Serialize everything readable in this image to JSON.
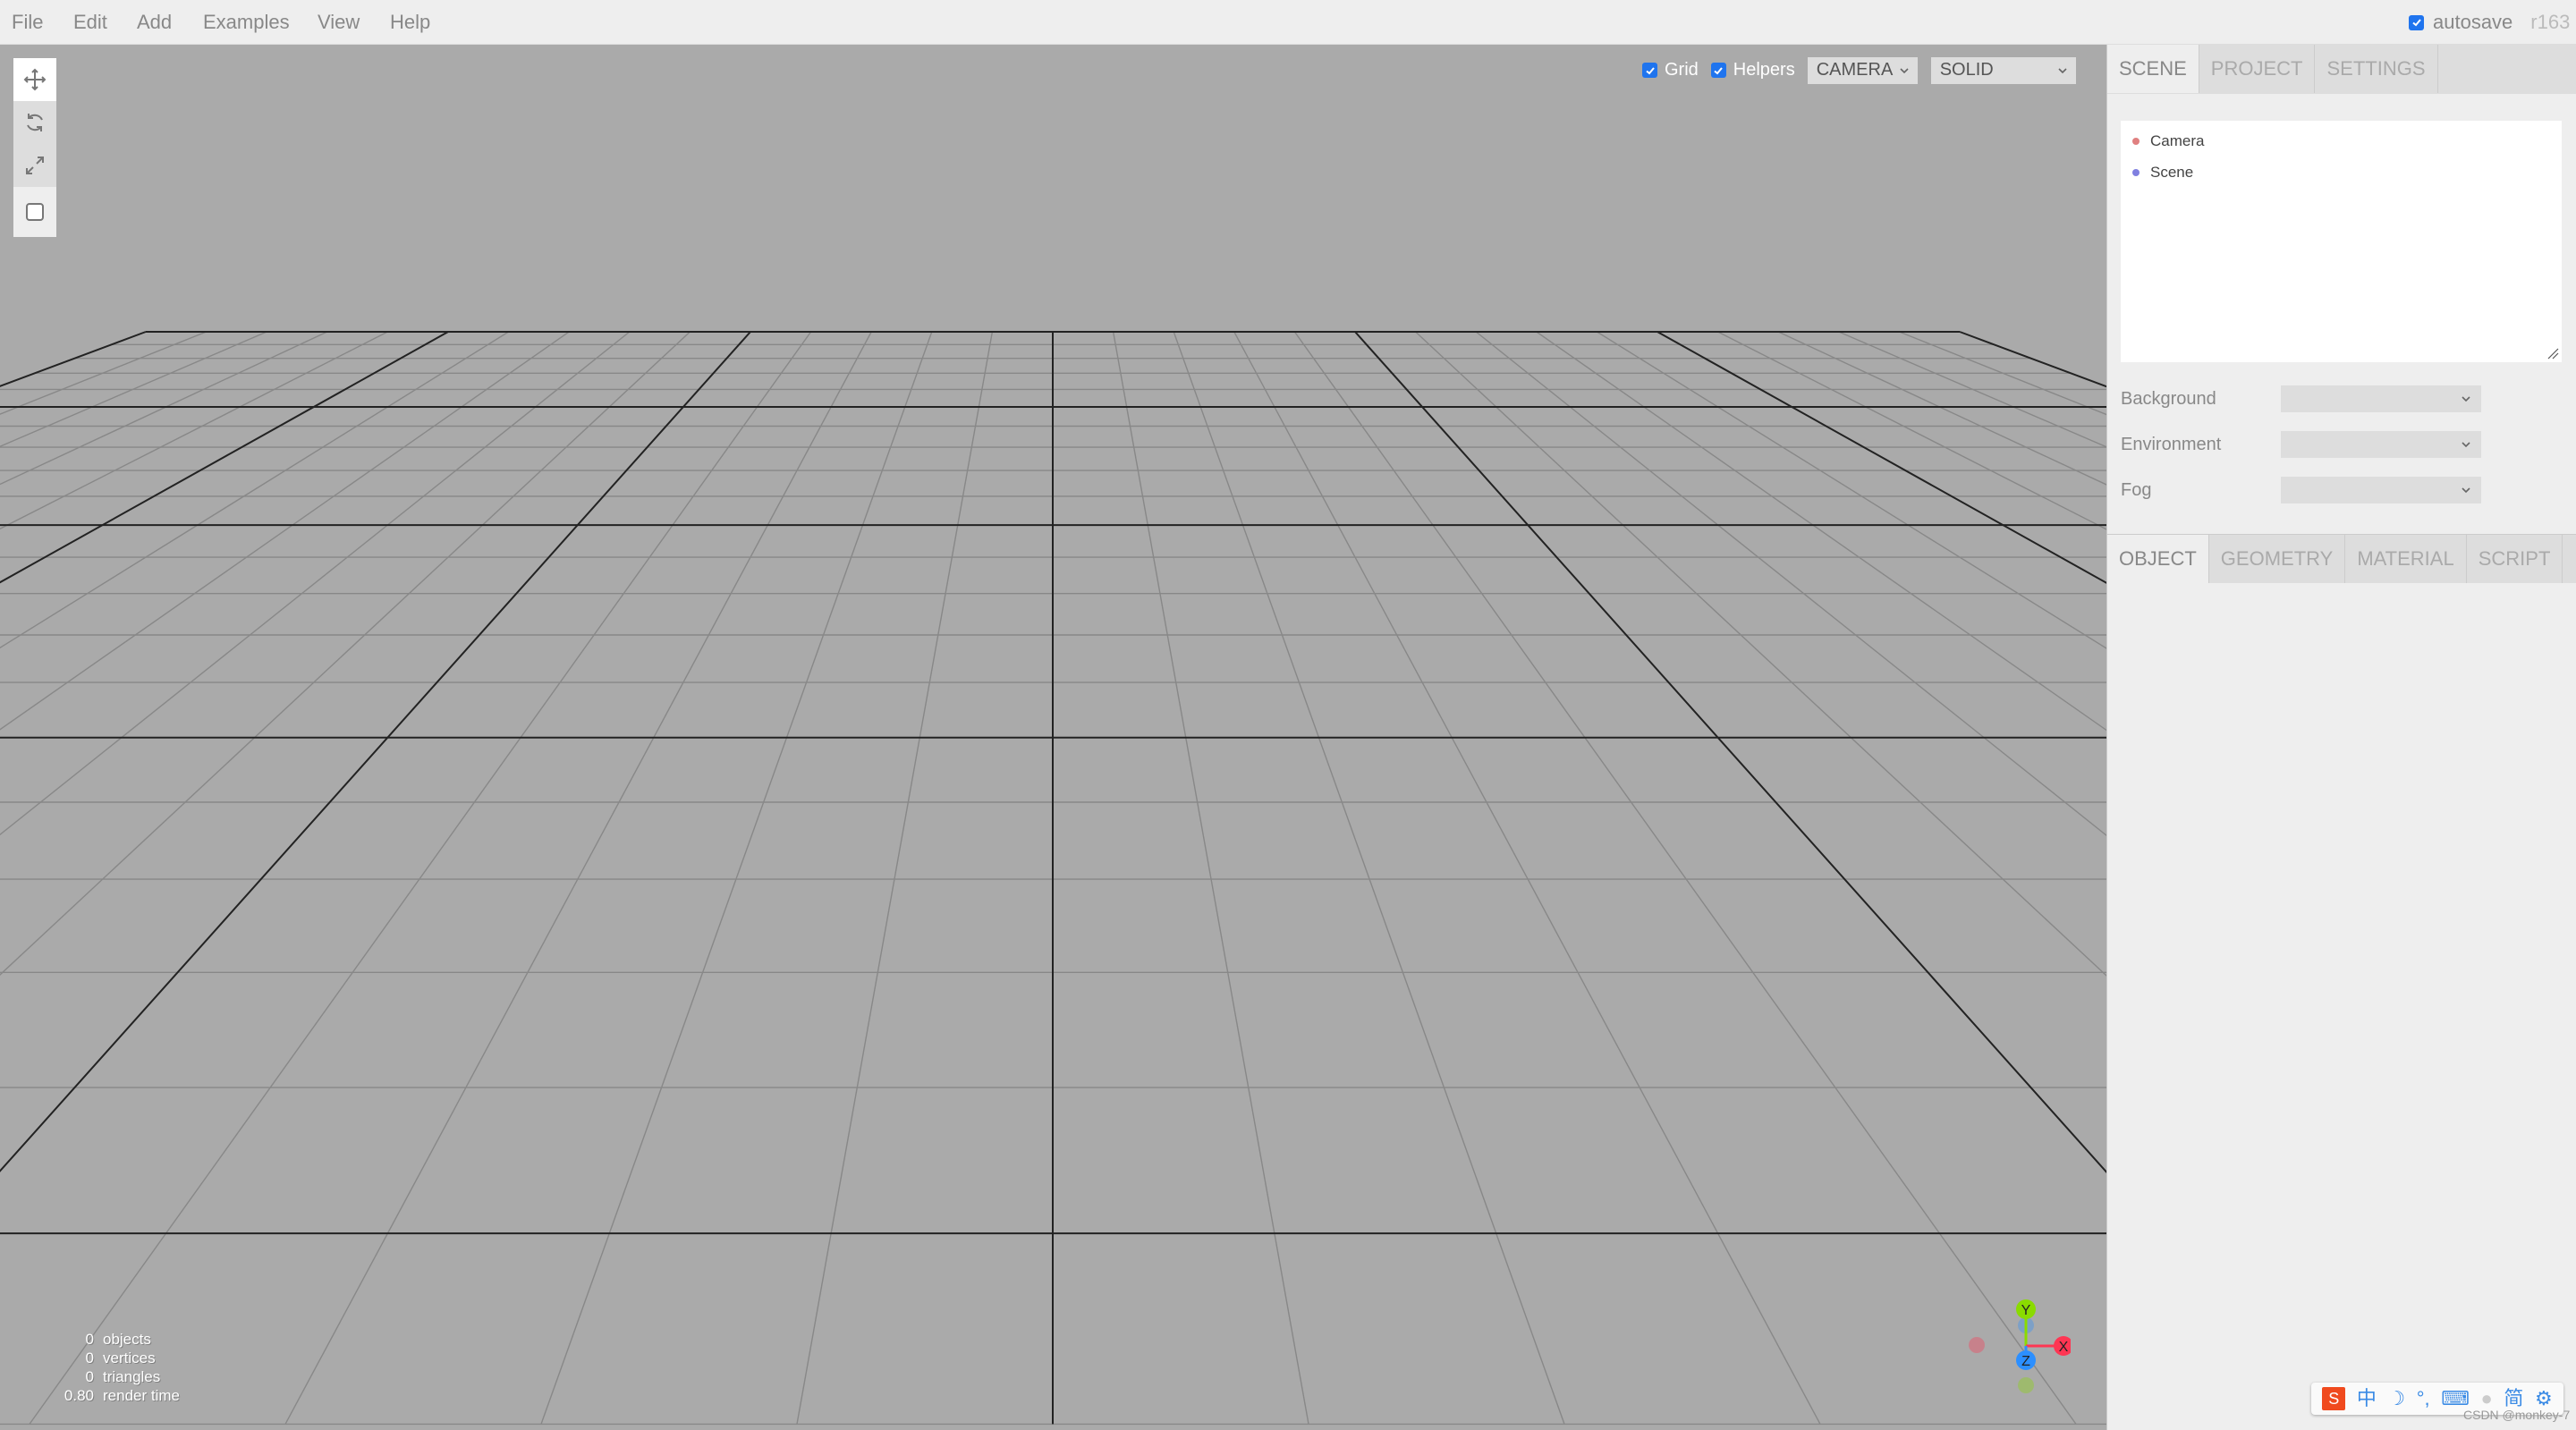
{
  "menubar": {
    "items": [
      {
        "label": "File"
      },
      {
        "label": "Edit"
      },
      {
        "label": "Add"
      },
      {
        "label": "Examples"
      },
      {
        "label": "View"
      },
      {
        "label": "Help"
      }
    ],
    "autosave": {
      "label": "autosave",
      "checked": true
    },
    "version": "r163"
  },
  "toolbar": {
    "tools": [
      {
        "name": "translate",
        "icon": "move-arrows-icon",
        "active": true
      },
      {
        "name": "rotate",
        "icon": "rotate-icon",
        "active": false
      },
      {
        "name": "scale",
        "icon": "scale-arrows-icon",
        "active": false
      },
      {
        "name": "local",
        "icon": "checkbox-icon",
        "active": false
      }
    ]
  },
  "viewport": {
    "grid": {
      "label": "Grid",
      "checked": true
    },
    "helpers": {
      "label": "Helpers",
      "checked": true
    },
    "camera_select": {
      "value": "CAMERA"
    },
    "shading_select": {
      "value": "SOLID"
    },
    "grid_colors": {
      "background": "#aaaaaa",
      "major": "#222222",
      "minor": "#888888"
    },
    "info": [
      {
        "value": "0",
        "label": "objects"
      },
      {
        "value": "0",
        "label": "vertices"
      },
      {
        "value": "0",
        "label": "triangles"
      },
      {
        "value": "0.80",
        "label": "render time"
      }
    ],
    "gizmo": {
      "x": {
        "label": "X",
        "color": "#ff3653"
      },
      "y": {
        "label": "Y",
        "color": "#8adb00"
      },
      "z": {
        "label": "Z",
        "color": "#2c8fff"
      }
    }
  },
  "sidebar": {
    "top_tabs": [
      {
        "label": "SCENE",
        "selected": true
      },
      {
        "label": "PROJECT",
        "selected": false
      },
      {
        "label": "SETTINGS",
        "selected": false
      }
    ],
    "outliner": [
      {
        "label": "Camera",
        "color": "#e08080"
      },
      {
        "label": "Scene",
        "color": "#8080e0"
      }
    ],
    "properties": [
      {
        "label": "Background",
        "value": ""
      },
      {
        "label": "Environment",
        "value": ""
      },
      {
        "label": "Fog",
        "value": ""
      }
    ],
    "bottom_tabs": [
      {
        "label": "OBJECT",
        "selected": true
      },
      {
        "label": "GEOMETRY",
        "selected": false
      },
      {
        "label": "MATERIAL",
        "selected": false
      },
      {
        "label": "SCRIPT",
        "selected": false
      }
    ]
  },
  "ime_bar": {
    "items": [
      "sogou-logo",
      "中",
      "moon",
      "°,",
      "keyboard",
      "user",
      "简",
      "gear"
    ],
    "logo_text": "S",
    "chinese_label": "中",
    "simplified_label": "简"
  },
  "watermark": "CSDN @monkey-7"
}
